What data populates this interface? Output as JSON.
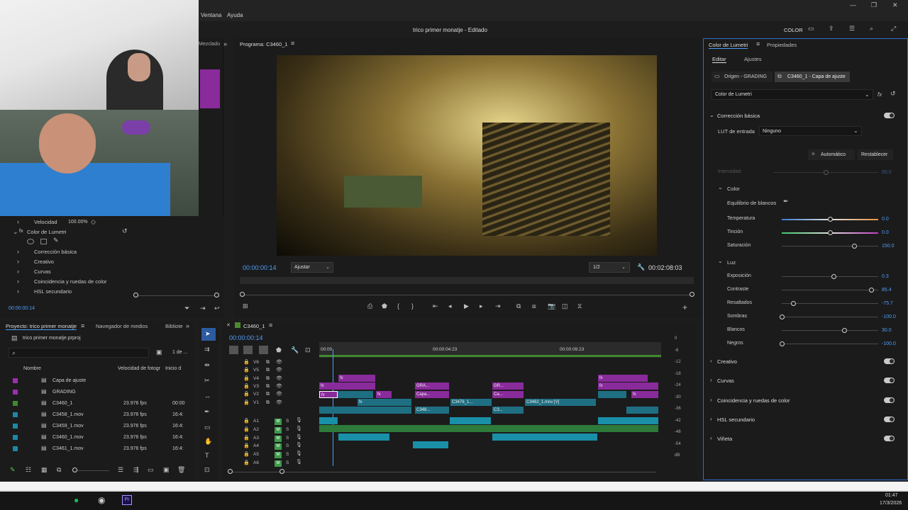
{
  "window": {
    "title": "trico primer monatje - Editado",
    "workspace": "COLOR"
  },
  "menu": [
    "Ventana",
    "Ayuda"
  ],
  "source_panel": {
    "tab_mix": "Mezclado",
    "velocidad_label": "Velocidad",
    "velocidad_value": "100.00%",
    "lumetri_label": "Color de Lumetri",
    "items": [
      "Corrección básica",
      "Creativo",
      "Curvas",
      "Coincidencia y ruedas de color",
      "HSL secundario"
    ],
    "timecode": "00:00:00:14"
  },
  "program": {
    "title": "Programa: C3460_1",
    "timecode": "00:00:00:14",
    "fit": "Ajustar",
    "resolution": "1/2",
    "duration": "00:02:08:03"
  },
  "project": {
    "tab_project": "Proyecto: trico primer monatje",
    "tab_media": "Navegador de medios",
    "tab_lib": "Bibliote",
    "file": "trico primer monatje.prproj",
    "count": "1 de ...",
    "columns": [
      "Nombre",
      "Velocidad de fotogr",
      "Inicio d"
    ],
    "rows": [
      {
        "name": "Capa de ajuste",
        "fps": "",
        "start": "",
        "color": "#9b2fae"
      },
      {
        "name": "GRADING",
        "fps": "",
        "start": "",
        "color": "#9b2fae"
      },
      {
        "name": "C3460_1",
        "fps": "23.976 fps",
        "start": "00:00",
        "color": "#3e8a2e"
      },
      {
        "name": "C3458_1.mov",
        "fps": "23.976 fps",
        "start": "16:4:",
        "color": "#1e87a6"
      },
      {
        "name": "C3459_1.mov",
        "fps": "23.976 fps",
        "start": "16:4:",
        "color": "#1e87a6"
      },
      {
        "name": "C3460_1.mov",
        "fps": "23.976 fps",
        "start": "16:4:",
        "color": "#1e87a6"
      },
      {
        "name": "C3461_1.mov",
        "fps": "23.976 fps",
        "start": "16:4:",
        "color": "#1e87a6"
      }
    ]
  },
  "timeline": {
    "tab": "C3460_1",
    "timecode": "00:00:00:14",
    "ruler": [
      "00:00",
      "00:00:04:23",
      "00:00:09:23"
    ],
    "video_tracks": [
      "V6",
      "V5",
      "V4",
      "V3",
      "V2",
      "V1"
    ],
    "audio_tracks": [
      "A1",
      "A2",
      "A3",
      "A4",
      "A5",
      "A6"
    ],
    "clips": {
      "gra": "GRA...",
      "capa": "Capa...",
      "gr": "GR...",
      "ca": "Ca...",
      "c3476": "C3476_1...",
      "c3462": "C3462_1.mov [V]",
      "c348": "C348...",
      "c3": "C3..."
    },
    "meter": [
      "0",
      "-6",
      "-12",
      "-18",
      "-24",
      "-30",
      "-36",
      "-42",
      "-48",
      "-54",
      "dB"
    ]
  },
  "lumetri": {
    "tab": "Color de Lumetri",
    "tab_props": "Propiedades",
    "sub_edit": "Editar",
    "sub_adj": "Ajustes",
    "origin": "Origen - GRADING",
    "target": "C3460_1 - Capa de ajuste",
    "effect": "Color de Lumetri",
    "basic": "Corrección básica",
    "lut_label": "LUT de entrada",
    "lut_value": "Ninguno",
    "auto": "Automático",
    "reset": "Restablecer",
    "intensity": {
      "label": "Intensidad",
      "value": "50.0"
    },
    "color_header": "Color",
    "wb": "Equilibrio de blancos",
    "sliders_color": [
      {
        "label": "Temperatura",
        "value": "0.0",
        "pos": 0.5
      },
      {
        "label": "Tinción",
        "value": "0.0",
        "pos": 0.5
      },
      {
        "label": "Saturación",
        "value": "150.0",
        "pos": 0.75
      }
    ],
    "luz_header": "Luz",
    "sliders_luz": [
      {
        "label": "Exposición",
        "value": "0.3",
        "pos": 0.54
      },
      {
        "label": "Contraste",
        "value": "85.4",
        "pos": 0.93
      },
      {
        "label": "Resaltados",
        "value": "-75.7",
        "pos": 0.12
      },
      {
        "label": "Sombras",
        "value": "-100.0",
        "pos": 0.0
      },
      {
        "label": "Blancos",
        "value": "30.0",
        "pos": 0.65
      },
      {
        "label": "Negros",
        "value": "-100.0",
        "pos": 0.0
      }
    ],
    "sections": [
      "Creativo",
      "Curvas",
      "Coincidencia y ruedas de color",
      "HSL secundario",
      "Viñeta"
    ]
  },
  "taskbar": {
    "time": "01:47",
    "date": "17/3/2026"
  }
}
